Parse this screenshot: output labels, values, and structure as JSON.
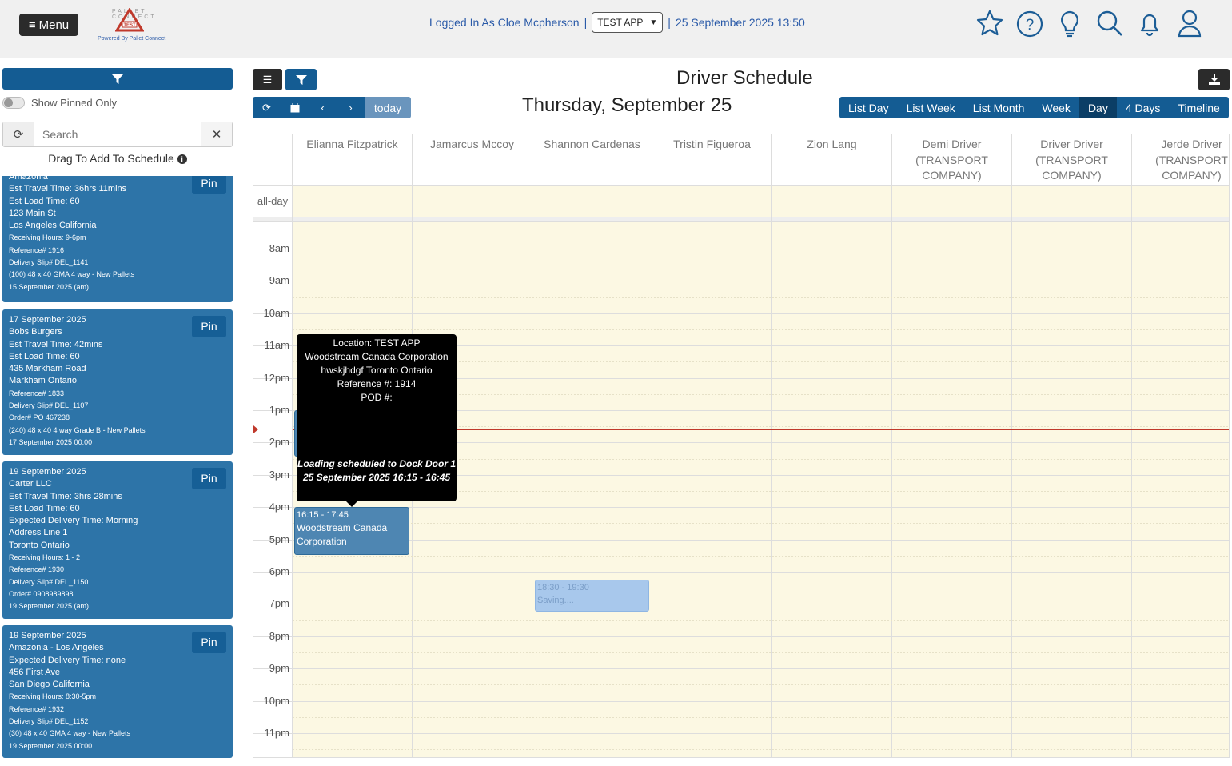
{
  "header": {
    "menu_label": "Menu",
    "logo_text": "PALLET CONNECT",
    "logo_badge": "TEST",
    "powered_by": "Powered By Pallet Connect",
    "logged_in": "Logged In As Cloe Mcpherson",
    "app_select_value": "TEST APP",
    "datetime": "25 September 2025 13:50",
    "icons": [
      "star-icon",
      "help-icon",
      "lightbulb-icon",
      "search-icon",
      "bell-icon",
      "user-icon"
    ]
  },
  "sidebar": {
    "show_pinned_label": "Show Pinned Only",
    "search_placeholder": "Search",
    "drag_hint": "Drag To Add To Schedule",
    "cards": [
      {
        "lines": [
          {
            "t": "Amazonia"
          },
          {
            "t": "Est Travel Time: 36hrs 11mins"
          },
          {
            "t": "Est Load Time: 60"
          },
          {
            "t": "123 Main St"
          },
          {
            "t": "Los Angeles California"
          },
          {
            "t": "Receiving Hours: 9-6pm",
            "s": true
          },
          {
            "t": "Reference# 1916",
            "s": true
          },
          {
            "t": "Delivery Slip# DEL_1141",
            "s": true
          },
          {
            "t": "(100) 48 x 40 GMA 4 way - New Pallets",
            "s": true
          },
          {
            "t": "15 September 2025 (am)",
            "s": true
          }
        ]
      },
      {
        "lines": [
          {
            "t": "17 September 2025"
          },
          {
            "t": "Bobs Burgers"
          },
          {
            "t": "Est Travel Time: 42mins"
          },
          {
            "t": "Est Load Time: 60"
          },
          {
            "t": "435 Markham Road"
          },
          {
            "t": "Markham Ontario"
          },
          {
            "t": "Reference# 1833",
            "s": true
          },
          {
            "t": "Delivery Slip# DEL_1107",
            "s": true
          },
          {
            "t": "Order# PO 467238",
            "s": true
          },
          {
            "t": "(240) 48 x 40 4 way Grade B - New Pallets",
            "s": true
          },
          {
            "t": "17 September 2025 00:00",
            "s": true
          }
        ]
      },
      {
        "lines": [
          {
            "t": "19 September 2025"
          },
          {
            "t": "Carter LLC"
          },
          {
            "t": "Est Travel Time: 3hrs 28mins"
          },
          {
            "t": "Est Load Time: 60"
          },
          {
            "t": "Expected Delivery Time: Morning"
          },
          {
            "t": "Address Line 1"
          },
          {
            "t": "Toronto Ontario"
          },
          {
            "t": "Receiving Hours: 1 - 2",
            "s": true
          },
          {
            "t": "Reference# 1930",
            "s": true
          },
          {
            "t": "Delivery Slip# DEL_1150",
            "s": true
          },
          {
            "t": "Order# 0908989898",
            "s": true
          },
          {
            "t": "19 September 2025 (am)",
            "s": true
          }
        ]
      },
      {
        "lines": [
          {
            "t": "19 September 2025"
          },
          {
            "t": "Amazonia - Los Angeles"
          },
          {
            "t": "Expected Delivery Time: none"
          },
          {
            "t": "456 First Ave"
          },
          {
            "t": "San Diego California"
          },
          {
            "t": "Receiving Hours: 8:30-5pm",
            "s": true
          },
          {
            "t": "Reference# 1932",
            "s": true
          },
          {
            "t": "Delivery Slip# DEL_1152",
            "s": true
          },
          {
            "t": "(30) 48 x 40 GMA 4 way - New Pallets",
            "s": true
          },
          {
            "t": "19 September 2025 00:00",
            "s": true
          }
        ]
      }
    ],
    "pin_label": "Pin"
  },
  "calendar": {
    "title": "Driver Schedule",
    "date_heading": "Thursday, September 25",
    "today_label": "today",
    "views": [
      "List Day",
      "List Week",
      "List Month",
      "Week",
      "Day",
      "4 Days",
      "Timeline"
    ],
    "active_view": "Day",
    "allday_label": "all-day",
    "drivers": [
      [
        "Elianna Fitzpatrick"
      ],
      [
        "Jamarcus Mccoy"
      ],
      [
        "Shannon Cardenas"
      ],
      [
        "Tristin Figueroa"
      ],
      [
        "Zion Lang"
      ],
      [
        "Demi Driver",
        "(TRANSPORT",
        "COMPANY)"
      ],
      [
        "Driver Driver",
        "(TRANSPORT",
        "COMPANY)"
      ],
      [
        "Jerde Driver",
        "(TRANSPORT",
        "COMPANY)"
      ]
    ],
    "hours": [
      "8am",
      "9am",
      "10am",
      "11am",
      "12pm",
      "1pm",
      "2pm",
      "3pm",
      "4pm",
      "5pm",
      "6pm",
      "7pm",
      "8pm",
      "9pm",
      "10pm",
      "11pm"
    ],
    "events": {
      "main_time": "16:15 - 17:45",
      "main_title": "Woodstream Canada Corporation",
      "saving_time": "18:30 - 19:30",
      "saving_text": "Saving...."
    },
    "tooltip": {
      "location": "Location: TEST APP",
      "company": "Woodstream Canada Corporation",
      "address": "hwskjhdgf Toronto Ontario",
      "reference": "Reference #: 1914",
      "pod": "POD #:",
      "loading": "Loading scheduled to Dock Door 1",
      "when": "25 September 2025 16:15 - 16:45"
    }
  },
  "colors": {
    "primary": "#145c93",
    "card": "#2d74a8",
    "dark_button": "#2b2b2b",
    "business_hours_bg": "#fcf8e3",
    "now_indicator": "#c0392b"
  }
}
